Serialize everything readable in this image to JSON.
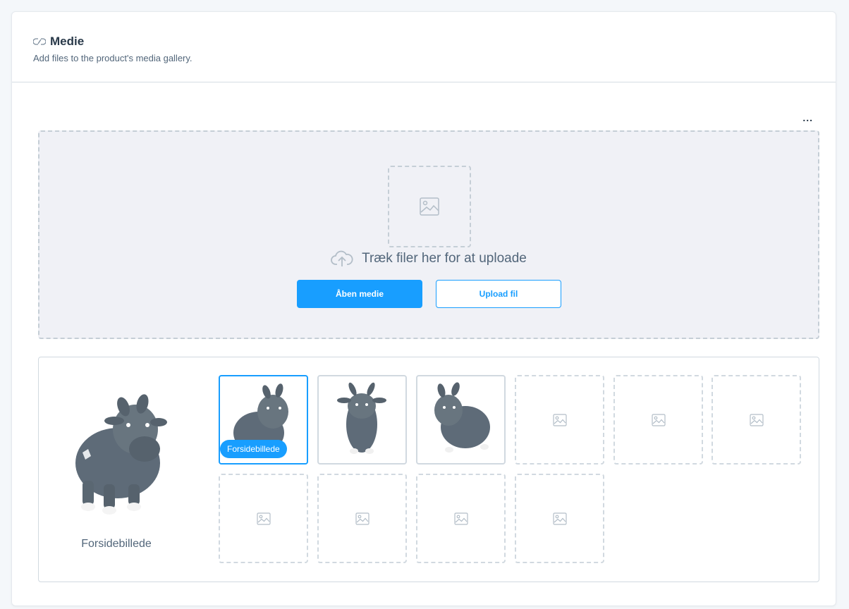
{
  "header": {
    "title": "Medie",
    "subtitle": "Add files to the product's media gallery.",
    "icon": "link-icon"
  },
  "toolbar": {
    "more_label": "..."
  },
  "dropzone": {
    "text": "Træk filer her for at uploade",
    "open_media_label": "Åben medie",
    "upload_file_label": "Upload fil",
    "icons": [
      "image-placeholder-icon",
      "cloud-upload-icon"
    ]
  },
  "gallery": {
    "cover_label": "Forsidebillede",
    "cover_badge": "Forsidebillede",
    "thumbnails": [
      {
        "state": "selected-cover"
      },
      {
        "state": "filled"
      },
      {
        "state": "filled"
      },
      {
        "state": "empty"
      },
      {
        "state": "empty"
      },
      {
        "state": "empty"
      },
      {
        "state": "empty"
      },
      {
        "state": "empty"
      },
      {
        "state": "empty"
      },
      {
        "state": "empty"
      }
    ]
  },
  "colors": {
    "accent": "#189eff",
    "text": "#52667a",
    "title": "#2a3a4a",
    "dropzone_bg": "#f0f1f6",
    "border": "#d1d9e0",
    "cow": "#5e6b78"
  }
}
